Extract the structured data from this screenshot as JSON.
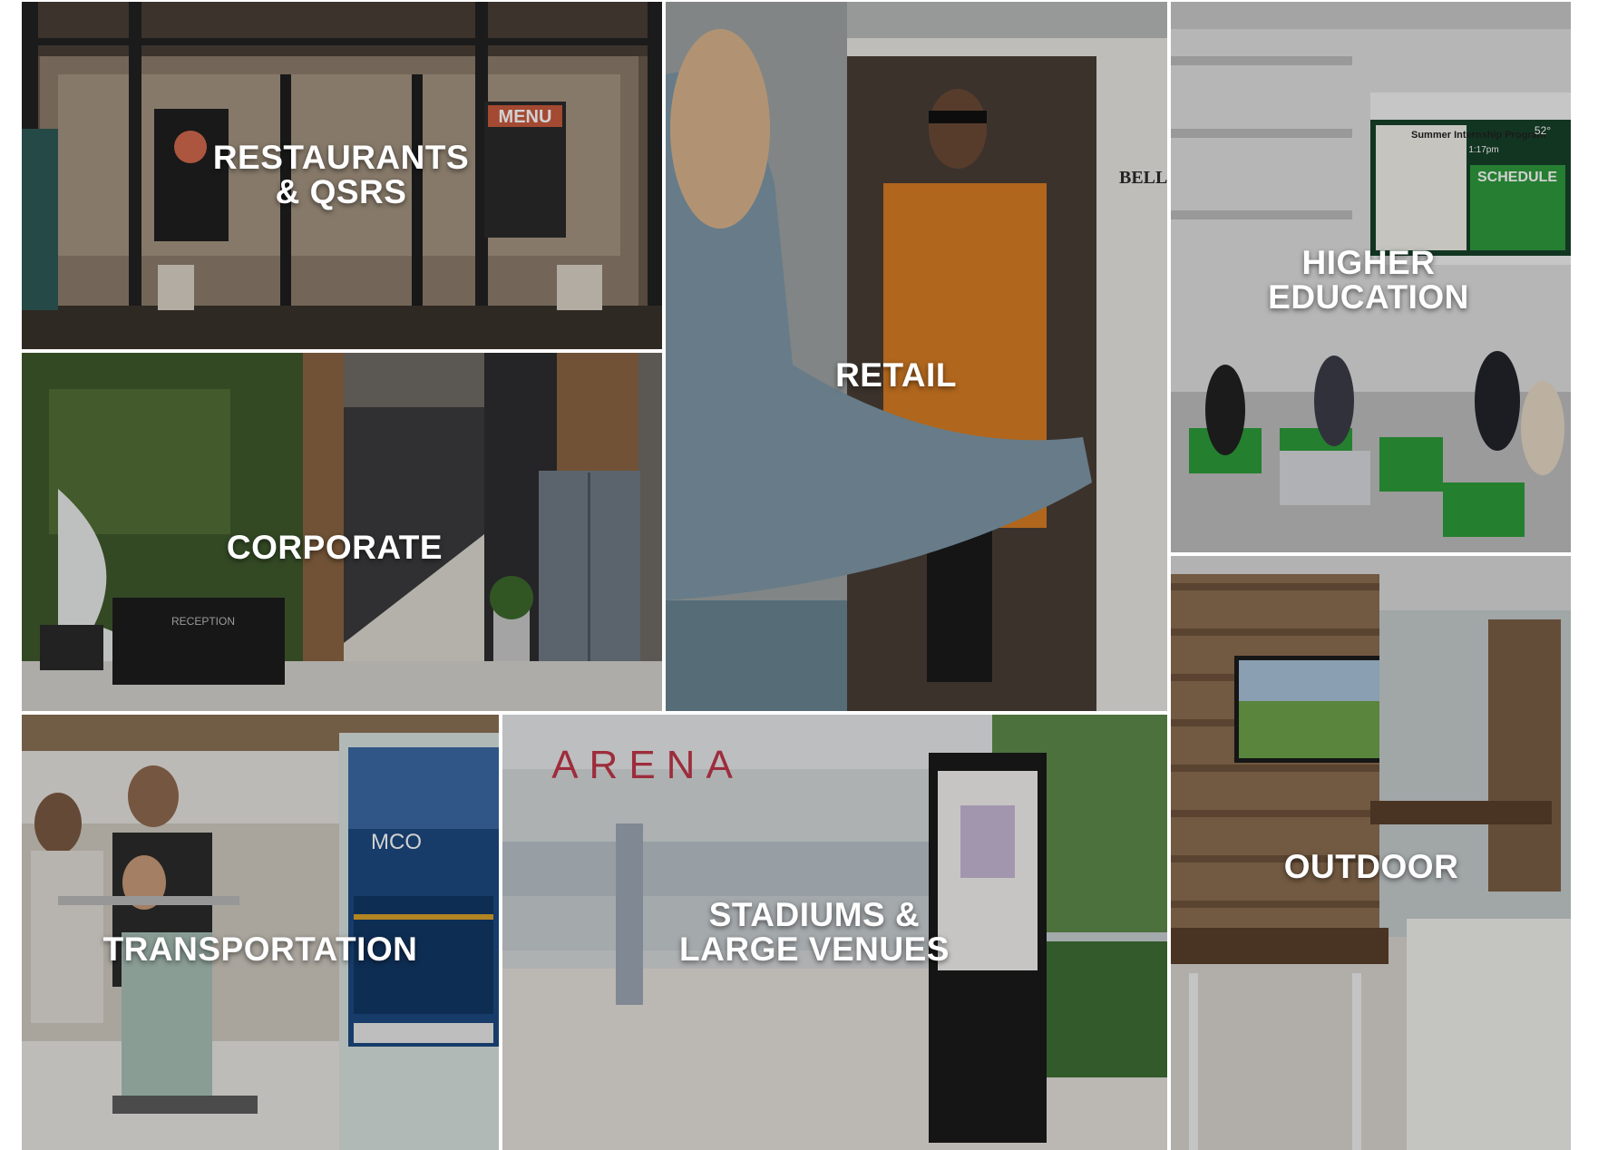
{
  "tiles": [
    {
      "id": "restaurants",
      "line1": "RESTAURANTS",
      "line2": "& QSRs",
      "image": "restaurant-storefront-image"
    },
    {
      "id": "retail",
      "line1": "RETAIL",
      "line2": "",
      "image": "retail-kiosk-image"
    },
    {
      "id": "higher-education",
      "line1": "HIGHER",
      "line2": "EDUCATION",
      "image": "campus-atrium-image"
    },
    {
      "id": "corporate",
      "line1": "CORPORATE",
      "line2": "",
      "image": "corporate-lobby-image"
    },
    {
      "id": "transportation",
      "line1": "TRANSPORTATION",
      "line2": "",
      "image": "airport-kiosk-image"
    },
    {
      "id": "stadiums",
      "line1": "STADIUMS &",
      "line2": "LARGE VENUES",
      "image": "arena-plaza-image"
    },
    {
      "id": "outdoor",
      "line1": "OUTDOOR",
      "line2": "",
      "image": "outdoor-patio-image"
    }
  ],
  "scene_text": {
    "menu_board": "MENU",
    "arena_sign": "ARENA",
    "reception_sign": "RECEPTION",
    "kiosk_code": "MCO",
    "edu_screen_title": "Summer Internship Program",
    "edu_screen_schedule": "SCHEDULE",
    "edu_screen_temp": "52°",
    "edu_screen_time": "1:17pm",
    "retail_screen_text": "BELL FALL SPICE"
  },
  "colors": {
    "label": "#ffffff",
    "restaurant_bg": "#5b4e42",
    "retail_bg": "#b6b7b6",
    "edu_bg": "#dcdcd9",
    "corporate_bg": "#6c6a66",
    "transport_bg": "#c9c4bb",
    "arena_bg": "#cfd2d3",
    "outdoor_bg": "#9d8f80",
    "accent_orange": "#e08a2b",
    "accent_green": "#2e9a3c"
  }
}
